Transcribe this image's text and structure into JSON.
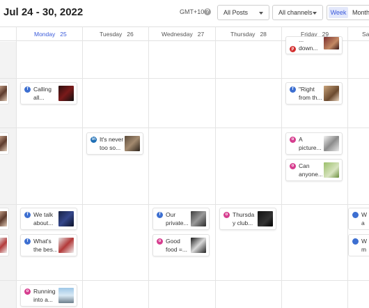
{
  "header": {
    "date_range": "Jul 24 - 30, 2022",
    "timezone": "GMT+10",
    "help_icon": "?",
    "filter_posts": "All Posts",
    "filter_channels": "All channels",
    "view_week": "Week",
    "view_month": "Month"
  },
  "days": [
    {
      "name": "Monday",
      "num": "25"
    },
    {
      "name": "Tuesday",
      "num": "26"
    },
    {
      "name": "Wednesday",
      "num": "27"
    },
    {
      "name": "Thursday",
      "num": "28"
    },
    {
      "name": "Friday",
      "num": "29"
    },
    {
      "name": "Sa",
      "num": ""
    }
  ],
  "posts": {
    "fri_top": "...\ndown...",
    "mon_calling": "Calling\nall...",
    "fri_right": "\"Right\nfrom th...",
    "tue_never": "It's never\ntoo so...",
    "fri_picture": "A\npicture...",
    "fri_anyone": "Can\nanyone...",
    "mon_talk": "We talk\nabout...",
    "wed_private": "Our\nprivate...",
    "thu_club": "Thursda\ny club...",
    "mon_best": "What's\nthe bes...",
    "wed_food": "Good\nfood =...",
    "mon_running": "Running\ninto a...",
    "sat_a": "W\na",
    "sat_b": "W\nm"
  },
  "colors": {
    "accent": "#3b5bdb",
    "facebook": "#3d6fd1",
    "instagram": "#d63e8f",
    "linkedin": "#1f6fb5",
    "pinterest": "#d32f2f"
  },
  "icons": {
    "facebook": "facebook-icon",
    "instagram": "instagram-icon",
    "linkedin": "linkedin-icon",
    "pinterest": "pinterest-icon"
  }
}
